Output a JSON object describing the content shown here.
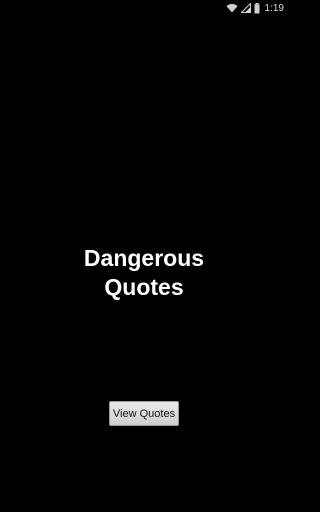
{
  "status_bar": {
    "time": "1:19",
    "icons": [
      "wifi-icon",
      "signal-icon",
      "battery-icon"
    ]
  },
  "main": {
    "title_line1": "Dangerous",
    "title_line2": "Quotes",
    "button_label": "View Quotes"
  },
  "colors": {
    "background": "#000000",
    "title": "#ffffff",
    "button_bg": "#dcdcdc",
    "button_text": "#111111"
  }
}
